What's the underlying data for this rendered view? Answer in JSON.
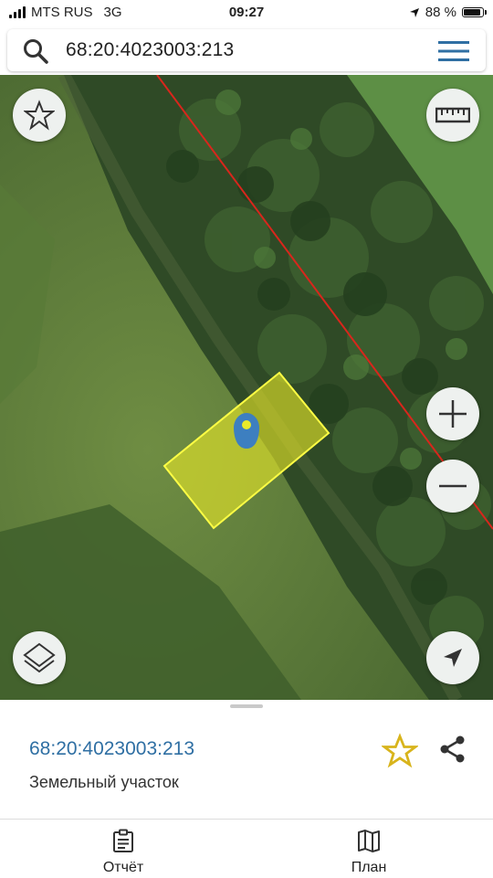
{
  "status_bar": {
    "carrier": "MTS RUS",
    "network": "3G",
    "time": "09:27",
    "battery_percent": "88 %",
    "battery_level": 0.88
  },
  "search": {
    "query": "68:20:4023003:213",
    "icon": "search-icon"
  },
  "map": {
    "type": "satellite",
    "boundary_line_color": "#d9261c",
    "parcel_fill_color": "#e6e628",
    "parcel_outline_color": "#ffff44",
    "marker_color": "#3d7fc0",
    "buttons": {
      "favorites": "star-outline-icon",
      "ruler": "ruler-icon",
      "zoom_in": "plus-icon",
      "zoom_out": "minus-icon",
      "layers": "layers-icon",
      "locate": "navigation-arrow-icon"
    }
  },
  "parcel": {
    "cadastral_number": "68:20:4023003:213",
    "type": "Земельный участок",
    "favorite_icon_color": "#d8b41c"
  },
  "tabs": [
    {
      "label": "Отчёт",
      "icon": "report-clipboard-icon"
    },
    {
      "label": "План",
      "icon": "map-plan-icon"
    }
  ]
}
